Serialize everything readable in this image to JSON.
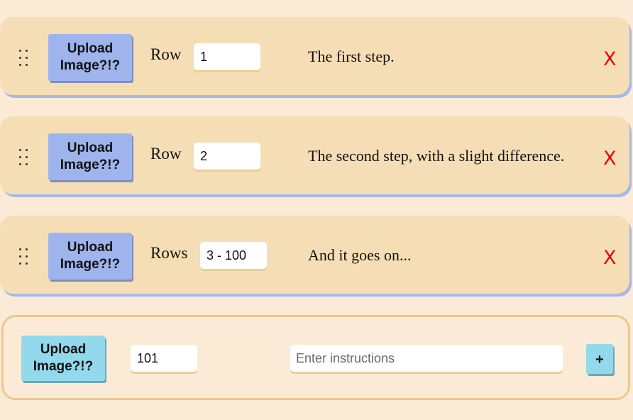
{
  "steps": [
    {
      "upload_label": "Upload Image?!?",
      "row_label": "Row",
      "row_value": "1",
      "text": "The first step.",
      "delete_label": "X"
    },
    {
      "upload_label": "Upload Image?!?",
      "row_label": "Row",
      "row_value": "2",
      "text": "The second step, with a slight difference.",
      "delete_label": "X"
    },
    {
      "upload_label": "Upload Image?!?",
      "row_label": "Rows",
      "row_value": "3 - 100",
      "text": "And it goes on...",
      "delete_label": "X"
    }
  ],
  "new_step": {
    "upload_label": "Upload Image?!?",
    "row_value": "101",
    "instructions_placeholder": "Enter instructions",
    "add_label": "+"
  },
  "colors": {
    "page_bg": "#fbebd6",
    "card_bg": "#f5deb5",
    "card_shadow": "#a4b9e8",
    "upload_blue": "#9fb4ec",
    "new_upload_cyan": "#93d9ec",
    "delete_red": "#e00a0a",
    "new_step_border": "#eac88e"
  },
  "icons": {
    "drag_handle": "drag-handle-icon",
    "delete": "close-icon",
    "add": "plus-icon"
  }
}
